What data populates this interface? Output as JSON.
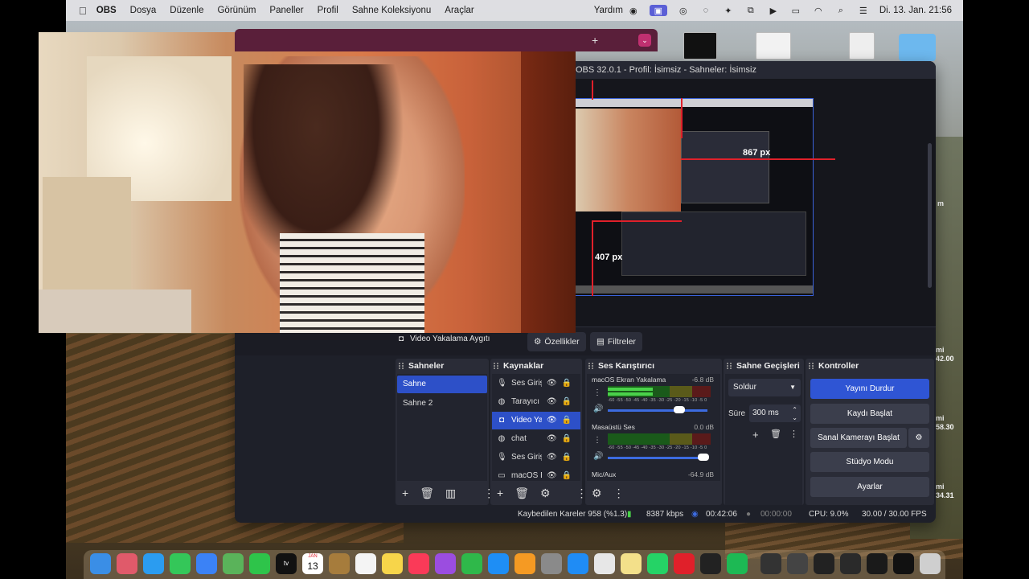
{
  "menubar": {
    "app": "OBS",
    "menus": [
      "Dosya",
      "Düzenle",
      "Görünüm",
      "Paneller",
      "Profil",
      "Sahne Koleksiyonu",
      "Araçlar"
    ],
    "help": "Yardım",
    "datetime": "Di. 13. Jan.  21:56"
  },
  "window": {
    "title": "OBS 32.0.1 - Profil: İsimsiz - Sahneler: İsimsiz"
  },
  "preview": {
    "width_label": "867 px",
    "height_label": "407 px"
  },
  "source_toolbar": {
    "source_name": "Video Yakalama Aygıtı",
    "properties_label": "Özellikler",
    "filters_label": "Filtreler"
  },
  "scenes": {
    "title": "Sahneler",
    "items": [
      "Sahne",
      "Sahne 2"
    ],
    "selected": "Sahne"
  },
  "sources": {
    "title": "Kaynaklar",
    "items": [
      {
        "name": "Ses Girişi",
        "icon": "mic-icon"
      },
      {
        "name": "Tarayıcı",
        "icon": "globe-icon"
      },
      {
        "name": "Video Yakalama Aygıtı",
        "icon": "camera-icon"
      },
      {
        "name": "chat",
        "icon": "globe-icon"
      },
      {
        "name": "Ses Girişi",
        "icon": "mic-icon"
      },
      {
        "name": "macOS Ekran Yakalama",
        "icon": "monitor-icon"
      }
    ],
    "selected_index": 2
  },
  "mixer": {
    "title": "Ses Karıştırıcı",
    "scale": "-60 -55 -50 -45 -40 -35 -30 -25 -20 -15 -10 -5 0",
    "channels": [
      {
        "name": "macOS Ekran Yakalama",
        "db": "-6.8 dB",
        "level": 0.2,
        "fader": 0.72
      },
      {
        "name": "Masaüstü Ses",
        "db": "0.0 dB",
        "level": 0.0,
        "fader": 0.96
      },
      {
        "name": "Mic/Aux",
        "db": "-64.9 dB"
      }
    ]
  },
  "transitions": {
    "title": "Sahne Geçişleri",
    "type": "Soldur",
    "duration_label": "Süre",
    "duration_value": "300 ms"
  },
  "controls": {
    "title": "Kontroller",
    "stop_stream": "Yayını Durdur",
    "start_record": "Kaydı Başlat",
    "virtual_cam": "Sanal Kamerayı Başlat",
    "studio_mode": "Stüdyo Modu",
    "settings": "Ayarlar"
  },
  "status": {
    "dropped": "Kaybedilen Kareler 958 (%1.3)",
    "bitrate": "8387 kbps",
    "stream_time": "00:42:06",
    "rec_time": "00:00:00",
    "cpu": "CPU: 9.0%",
    "fps": "30.00 / 30.00 FPS"
  },
  "desktop_labels": [
    "mi",
    "42.00",
    "mi",
    "58.30",
    "mi",
    "34.31",
    "m"
  ],
  "dock": {
    "calendar_month": "JAN",
    "calendar_day": "13"
  },
  "colors": {
    "accent": "#2f55d4",
    "preview_border": "#3a62d9",
    "guide_red": "#e0202a"
  }
}
